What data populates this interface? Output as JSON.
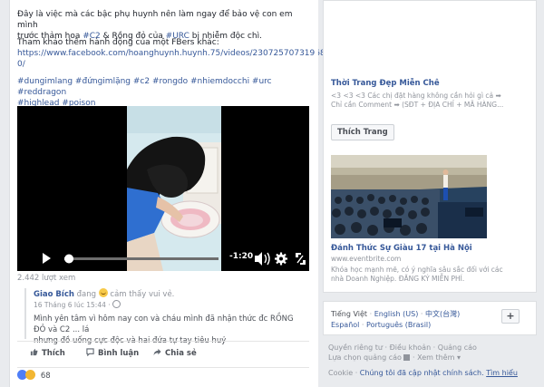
{
  "post": {
    "text_line1": "Đây là việc mà các bậc phụ huynh nên làm ngay để bảo vệ con em mình",
    "text_line2_a": "trước thảm hoạ ",
    "text_line2_tag1": "#C2",
    "text_line2_b": " & Rồng đỏ của ",
    "text_line2_tag2": "#URC",
    "text_line2_c": " bị nhiễm độc chì.",
    "text_ref": "Tham khảo thêm hành động của một FBers khác:",
    "link_line1": "https://www.facebook.com/hoanghuynh.huynh.75/videos/23072570731968",
    "link_line2": "0/",
    "hashtags_line1": "#dungimlang #đứngimlặng #c2 #rongdo #nhiemdocchi #urc #reddragon",
    "hashtags_line2": "#highlead #poison",
    "views": "2.442 lượt xem",
    "video": {
      "time": "-1:20",
      "progress": 0.03
    },
    "shared": {
      "author": "Giao Bích",
      "status_a": " đang ",
      "status_b": " cảm thấy vui vẻ.",
      "date": "16 Tháng 6 lúc 15:44 · ",
      "body_line1": "Mình yên tâm vì hôm nay con và cháu mình đã nhận thức đc RỒNG ĐỎ và C2 ... lá",
      "body_line2": "nhưng đồ uống cực độc và hai đứa tự tay tiêu huỷ"
    },
    "actions": {
      "like": "Thích",
      "comment": "Bình luận",
      "share": "Chia sẻ"
    },
    "reaction_count": "68"
  },
  "ads": {
    "ad1": {
      "title": "Thời Trang Đẹp Miễn Chê",
      "desc_line1": "<3 <3 <3 Các chị đặt hàng không cần hỏi gì cả ➡",
      "desc_line2": "Chỉ cần Comment ➡ (SĐT + ĐỊA CHỈ + MÃ HÀNG...",
      "button": "Thích Trang"
    },
    "ad2": {
      "title": "Đánh Thức Sự Giàu 17 tại Hà Nội",
      "domain": "www.eventbrite.com",
      "desc_line1": "Khóa học mạnh mẽ, có ý nghĩa sâu sắc đối với các",
      "desc_line2": "nhà Doanh Nghiệp. ĐĂNG KÝ MIỄN PHÍ."
    }
  },
  "languages": {
    "current": "Tiếng Việt",
    "sep": " · ",
    "opt1": "English (US)",
    "opt2": "中文(台灣)",
    "opt3": "Español",
    "opt4": "Português (Brasil)",
    "add": "+"
  },
  "footer": {
    "line1_a": "Quyền riêng tư",
    "line1_b": "Điều khoản",
    "line1_c": "Quảng cáo",
    "line2_a": "Lựa chọn quảng cáo",
    "line2_b": "Xem thêm",
    "cookie_a": "Cookie",
    "cookie_b": "Chúng tôi đã cập nhật chính sách.",
    "cookie_c": "Tìm hiểu"
  }
}
